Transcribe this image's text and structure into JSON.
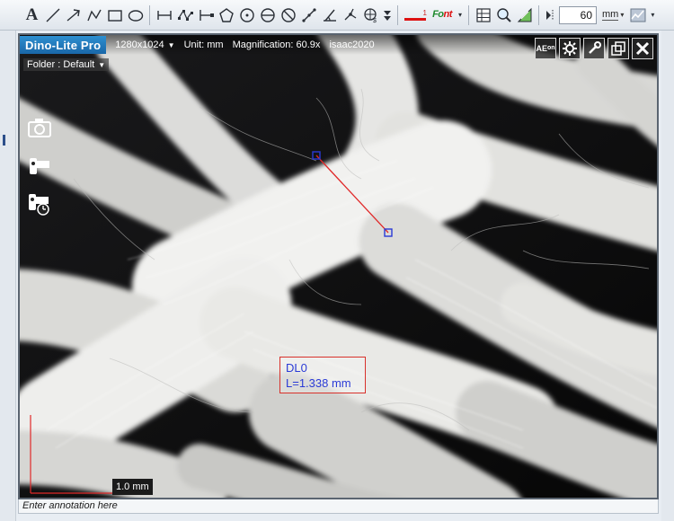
{
  "toolbar": {
    "tools": [
      "text-tool",
      "line-tool",
      "arrow-tool",
      "polyline-tool",
      "rectangle-tool",
      "ellipse-tool",
      "distance-tool",
      "multi-point-tool",
      "connected-line-tool",
      "polygon-tool",
      "circle-tool",
      "diameter-circle-tool",
      "arc-tool",
      "angle-tool",
      "four-point-angle-tool",
      "center-tool",
      "export-tool"
    ],
    "text_tool_glyph": "A",
    "line_width_value": "1",
    "font_label_part1": "Fo",
    "font_label_part2": "nt",
    "zoom_value": "60",
    "unit_label": "mm"
  },
  "viewer": {
    "brand": "Dino-Lite Pro",
    "resolution": "1280x1024",
    "unit": "Unit: mm",
    "magnification": "Magnification:  60.9x",
    "user": "isaac2020",
    "folder": "Folder : Default",
    "ae_line1": "AE",
    "ae_line2": "on",
    "measurement": {
      "name": "DL0",
      "length": "L=1.338 mm"
    },
    "scale_bar_label": "1.0 mm"
  },
  "annotation_placeholder": "Enter annotation here",
  "colors": {
    "brand_blue": "#1f7bc0",
    "measure_line": "#e02828",
    "measure_text": "#2a3ad6",
    "fiber": "#f2f2f0",
    "background": "#0b0b0c"
  }
}
